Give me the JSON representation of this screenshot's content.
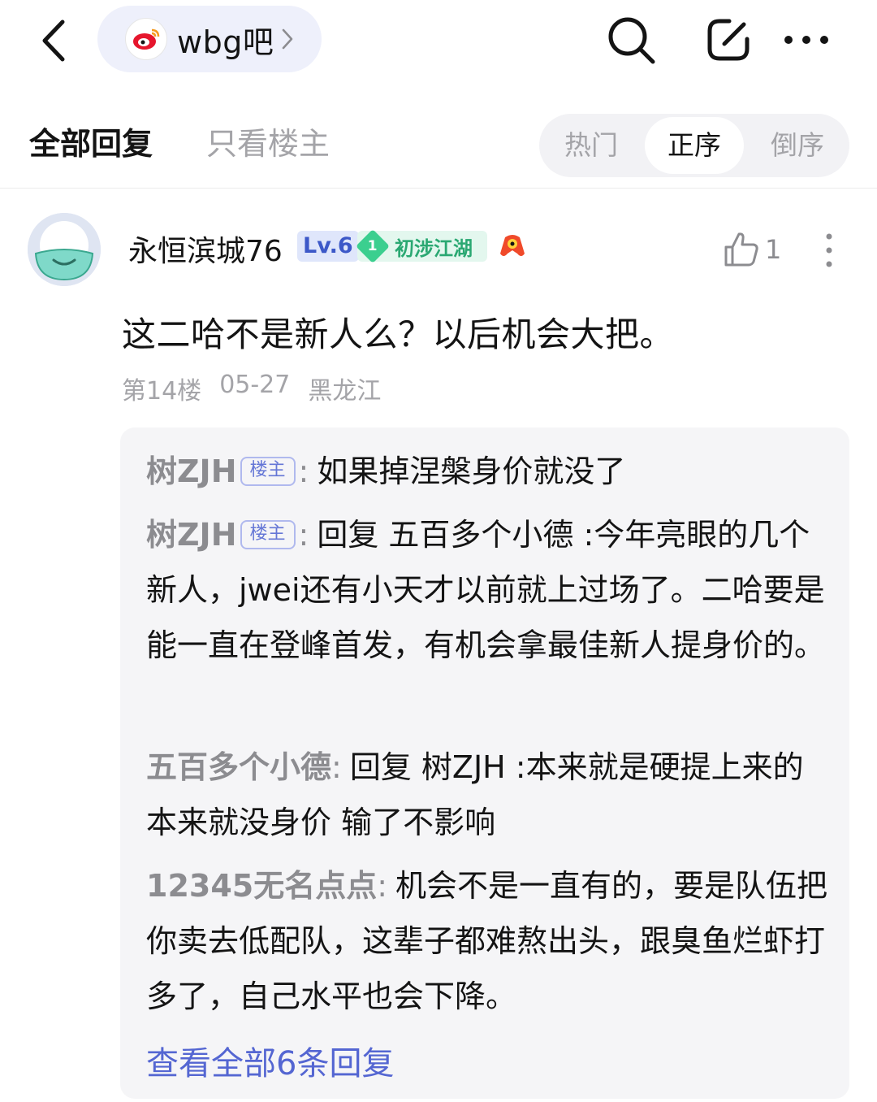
{
  "header": {
    "forum_name": "wbg吧",
    "icons": [
      "back-icon",
      "weibo-logo-icon",
      "chevron-right-icon",
      "search-icon",
      "edit-icon",
      "more-icon"
    ]
  },
  "tabs": {
    "all_replies": "全部回复",
    "op_only": "只看楼主"
  },
  "sort": {
    "hot": "热门",
    "ascending": "正序",
    "descending": "倒序",
    "selected": "正序"
  },
  "post": {
    "username": "永恒滨城76",
    "level": "Lv.6",
    "rank_number": "1",
    "rank_label": "初涉江湖",
    "like_count": "1",
    "content": "这二哈不是新人么？以后机会大把。",
    "floor": "第14楼",
    "date": "05-27",
    "location": "黑龙江"
  },
  "replies": [
    {
      "author": "树ZJH",
      "op_tag": "楼主",
      "text": "如果掉涅槃身价就没了"
    },
    {
      "author": "树ZJH",
      "op_tag": "楼主",
      "text": "回复 五百多个小德 :今年亮眼的几个新人，jwei还有小天才以前就上过场了。二哈要是能一直在登峰首发，有机会拿最佳新人提身价的。"
    },
    {
      "author": "五百多个小德",
      "op_tag": "",
      "text": "回复 树ZJH :本来就是硬提上来的 本来就没身价 输了不影响"
    },
    {
      "author": "12345无名点点",
      "op_tag": "",
      "text": "机会不是一直有的，要是队伍把你卖去低配队，这辈子都难熬出头，跟臭鱼烂虾打多了，自己水平也会下降。"
    }
  ],
  "view_all": "查看全部6条回复",
  "colors": {
    "accent": "#5466d2",
    "pill_bg": "#eef0fb",
    "reply_bg": "#f5f5f7",
    "muted": "#a4a4a8"
  }
}
